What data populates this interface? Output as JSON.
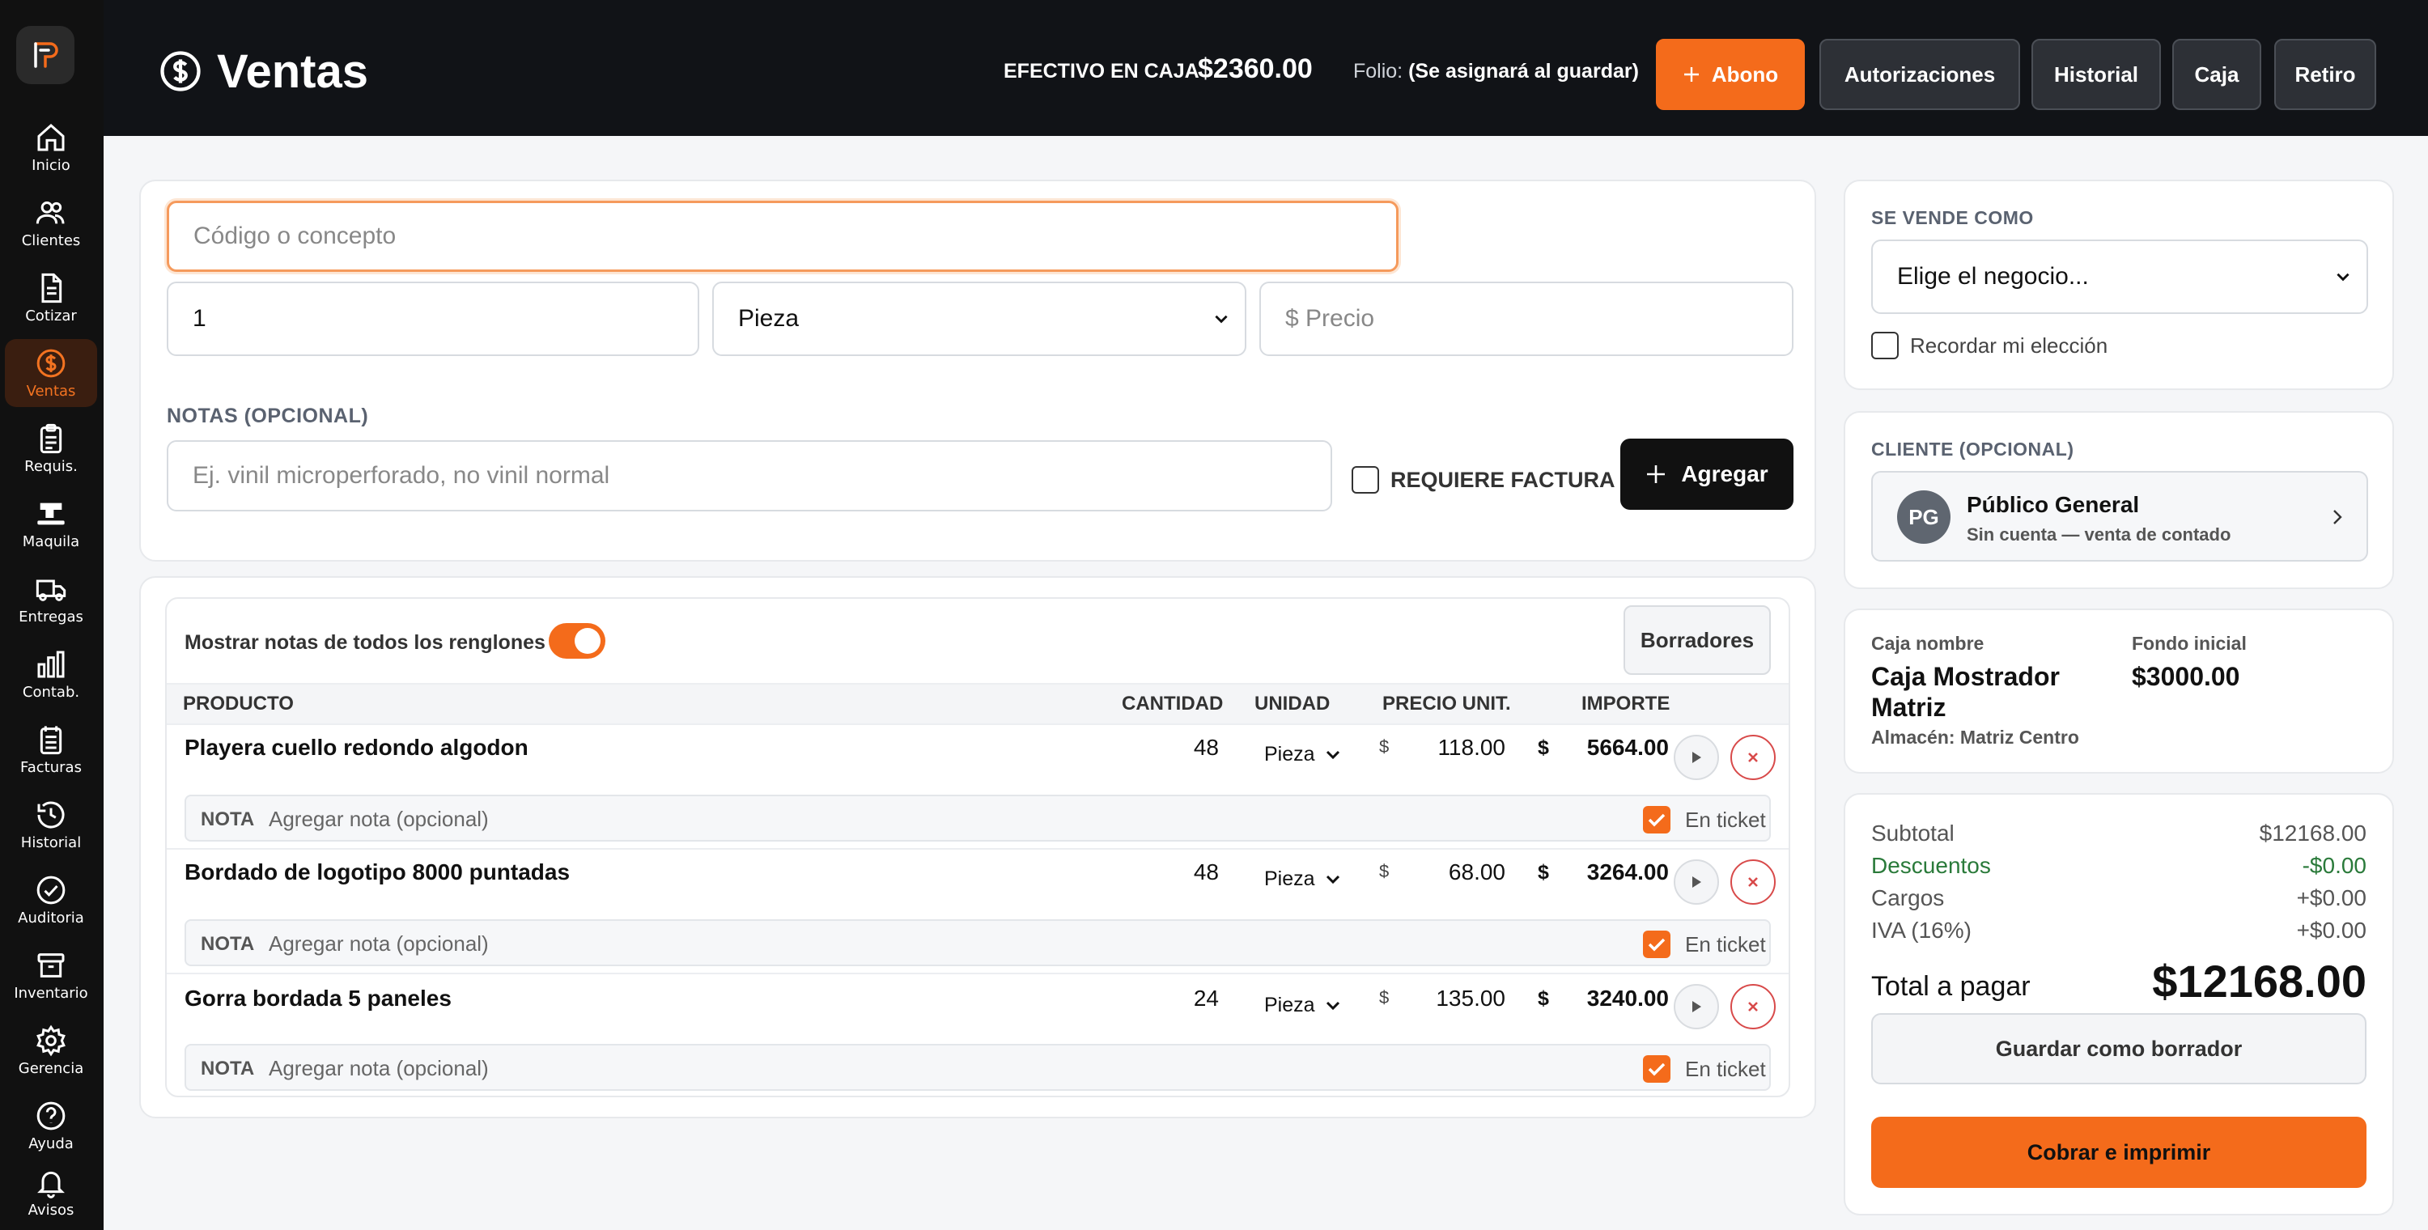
{
  "sidebar": {
    "items": [
      {
        "label": "Inicio",
        "icon": "home-icon"
      },
      {
        "label": "Clientes",
        "icon": "users-icon"
      },
      {
        "label": "Cotizar",
        "icon": "document-icon"
      },
      {
        "label": "Ventas",
        "icon": "dollar-icon"
      },
      {
        "label": "Requis.",
        "icon": "clipboard-icon"
      },
      {
        "label": "Maquila",
        "icon": "sewing-machine-icon"
      },
      {
        "label": "Entregas",
        "icon": "truck-icon"
      },
      {
        "label": "Contab.",
        "icon": "bar-chart-icon"
      },
      {
        "label": "Facturas",
        "icon": "invoices-icon"
      },
      {
        "label": "Historial",
        "icon": "history-icon"
      },
      {
        "label": "Auditoria",
        "icon": "check-circle-icon"
      },
      {
        "label": "Inventario",
        "icon": "archive-icon"
      },
      {
        "label": "Gerencia",
        "icon": "gear-icon"
      },
      {
        "label": "Ayuda",
        "icon": "help-icon"
      },
      {
        "label": "Avisos",
        "icon": "bell-icon"
      }
    ],
    "active": "Ventas"
  },
  "header": {
    "title": "Ventas",
    "cash_label": "EFECTIVO EN CAJA",
    "cash_value": "$2360.00",
    "folio_label": "Folio:",
    "folio_value": "(Se asignará al guardar)",
    "buttons": {
      "abono": "Abono",
      "autorizaciones": "Autorizaciones",
      "historial": "Historial",
      "caja": "Caja",
      "retiro": "Retiro"
    }
  },
  "entry": {
    "code_placeholder": "Código o concepto",
    "quantity_value": "1",
    "unit_value": "Pieza",
    "price_placeholder": "$ Precio",
    "notes_label": "NOTAS (OPCIONAL)",
    "notes_placeholder": "Ej. vinil microperforado, no vinil normal",
    "invoice_label": "REQUIERE FACTURA",
    "add_button": "Agregar"
  },
  "table": {
    "toggle_label": "Mostrar notas de todos los renglones",
    "drafts_button": "Borradores",
    "headers": {
      "product": "PRODUCTO",
      "quantity": "CANTIDAD",
      "unit": "UNIDAD",
      "unit_price": "PRECIO UNIT.",
      "amount": "IMPORTE"
    },
    "currency": "$",
    "note_tag": "NOTA",
    "note_placeholder": "Agregar nota (opcional)",
    "in_ticket_label": "En ticket",
    "rows": [
      {
        "product": "Playera cuello redondo algodon",
        "quantity": "48",
        "unit": "Pieza",
        "price": "118.00",
        "amount": "5664.00"
      },
      {
        "product": "Bordado de logotipo 8000 puntadas",
        "quantity": "48",
        "unit": "Pieza",
        "price": "68.00",
        "amount": "3264.00"
      },
      {
        "product": "Gorra bordada 5 paneles",
        "quantity": "24",
        "unit": "Pieza",
        "price": "135.00",
        "amount": "3240.00"
      }
    ]
  },
  "right": {
    "sold_as_label": "SE VENDE COMO",
    "business_select": "Elige el negocio...",
    "remember_label": "Recordar mi elección",
    "client_label": "CLIENTE (OPCIONAL)",
    "client_initials": "PG",
    "client_name": "Público General",
    "client_sub": "Sin cuenta — venta de contado",
    "cash_name_label": "Caja nombre",
    "cash_name_line1": "Caja Mostrador",
    "cash_name_line2": "Matriz",
    "warehouse": "Almacén: Matriz Centro",
    "initial_fund_label": "Fondo inicial",
    "initial_fund_value": "$3000.00",
    "summary": {
      "subtotal_label": "Subtotal",
      "subtotal": "$12168.00",
      "discounts_label": "Descuentos",
      "discounts": "-$0.00",
      "charges_label": "Cargos",
      "charges": "+$0.00",
      "iva_label": "IVA (16%)",
      "iva": "+$0.00",
      "total_label": "Total a pagar",
      "total": "$12168.00"
    },
    "save_draft_button": "Guardar como borrador",
    "charge_button": "Cobrar e imprimir"
  },
  "colors": {
    "accent": "#f46b1b",
    "dark": "#111317",
    "danger": "#d84a4a",
    "discount": "#2a7a3a"
  }
}
